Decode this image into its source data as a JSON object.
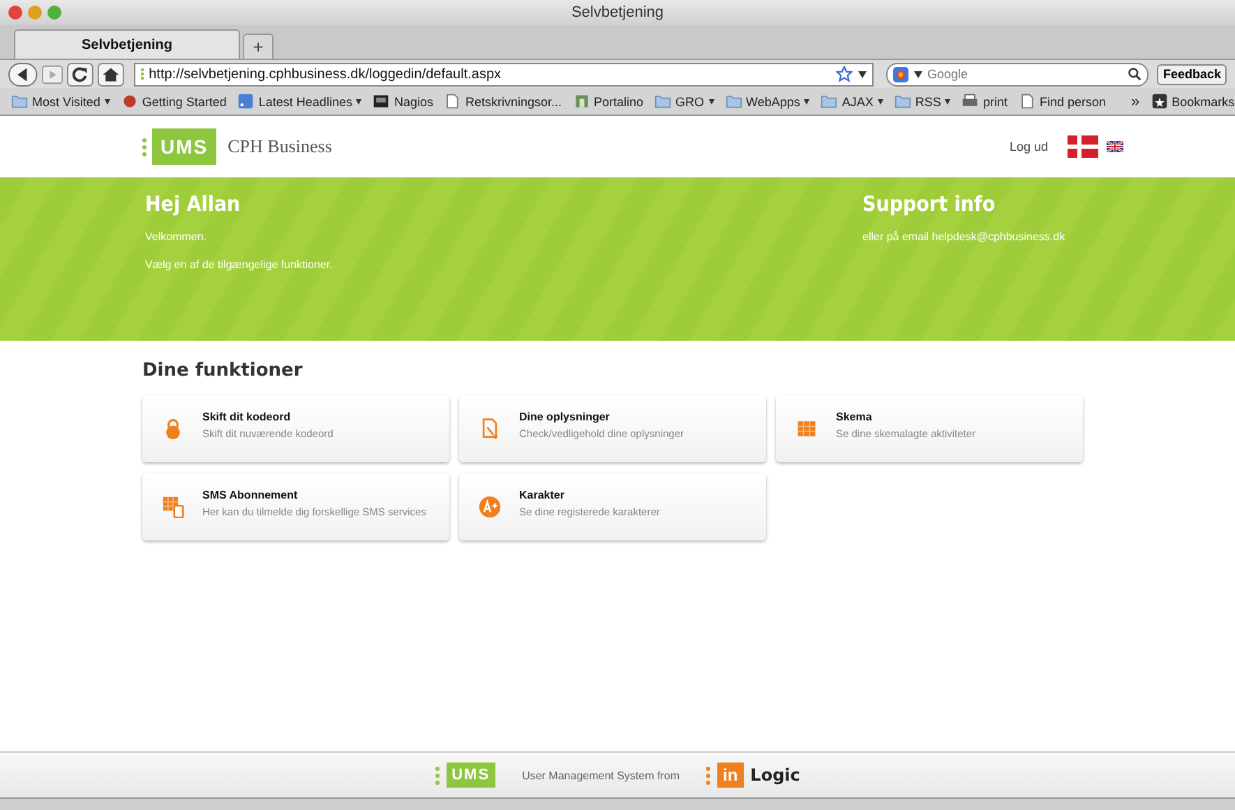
{
  "window": {
    "title": "Selvbetjening"
  },
  "tabs": [
    {
      "label": "Selvbetjening",
      "selected": true
    }
  ],
  "new_tab": "+",
  "address": "http://selvbetjening.cphbusiness.dk/loggedin/default.aspx",
  "search": {
    "placeholder": "Google"
  },
  "feedback": "Feedback",
  "bookmarks": [
    {
      "label": "Most Visited",
      "kind": "menu"
    },
    {
      "label": "Getting Started",
      "kind": "link"
    },
    {
      "label": "Latest Headlines",
      "kind": "menu"
    },
    {
      "label": "Nagios",
      "kind": "link"
    },
    {
      "label": "Retskrivningsor...",
      "kind": "link"
    },
    {
      "label": "Portalino",
      "kind": "link"
    },
    {
      "label": "GRO",
      "kind": "menu"
    },
    {
      "label": "WebApps",
      "kind": "menu"
    },
    {
      "label": "AJAX",
      "kind": "menu"
    },
    {
      "label": "RSS",
      "kind": "menu"
    },
    {
      "label": "print",
      "kind": "link"
    },
    {
      "label": "Find person",
      "kind": "link"
    }
  ],
  "bookmarks_more": "»",
  "bookmarks_menu": "Bookmarks",
  "site": {
    "logo": "UMS",
    "name": "CPH Business",
    "logout": "Log ud"
  },
  "banner": {
    "greeting": "Hej Allan",
    "lines": [
      "Velkommen.",
      "Vælg en af de tilgængelige funktioner."
    ],
    "support_title": "Support info",
    "support_text": "eller på email helpdesk@cphbusiness.dk"
  },
  "section_title": "Dine funktioner",
  "functions": [
    {
      "title": "Skift dit kodeord",
      "description": "Skift dit nuværende kodeord"
    },
    {
      "title": "Dine oplysninger",
      "description": "Check/vedligehold dine oplysninger"
    },
    {
      "title": "Skema",
      "description": "Se dine skemalagte aktiviteter"
    },
    {
      "title": "SMS Abonnement",
      "description": "Her kan du tilmelde dig forskellige SMS services"
    },
    {
      "title": "Karakter",
      "description": "Se dine registerede karakterer"
    }
  ],
  "footer": {
    "logo": "UMS",
    "text": "User Management System from",
    "brand_mark": "in",
    "brand_name": "Logic"
  }
}
